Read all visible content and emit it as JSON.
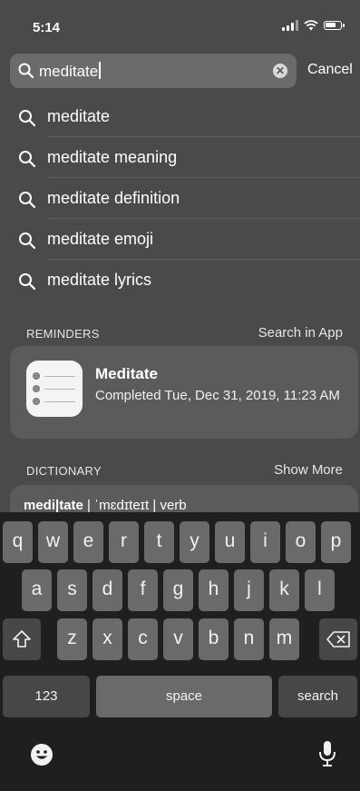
{
  "status_bar": {
    "time": "5:14"
  },
  "search": {
    "query": "meditate",
    "cancel_label": "Cancel"
  },
  "suggestions": [
    "meditate",
    "meditate meaning",
    "meditate definition",
    "meditate emoji",
    "meditate lyrics"
  ],
  "reminders": {
    "header": "REMINDERS",
    "action": "Search in App",
    "result": {
      "title": "Meditate",
      "detail": "Completed Tue, Dec 31, 2019, 11:23 AM",
      "icon": "reminders-app-icon"
    }
  },
  "dictionary": {
    "header": "DICTIONARY",
    "action": "Show More",
    "word": "medi|tate",
    "separator_1": " | ",
    "pronunciation": "ˈmɛdɪteɪt",
    "separator_2": " | ",
    "part_of_speech": "verb"
  },
  "keyboard": {
    "row1": [
      "q",
      "w",
      "e",
      "r",
      "t",
      "y",
      "u",
      "i",
      "o",
      "p"
    ],
    "row2": [
      "a",
      "s",
      "d",
      "f",
      "g",
      "h",
      "j",
      "k",
      "l"
    ],
    "row3": [
      "z",
      "x",
      "c",
      "v",
      "b",
      "n",
      "m"
    ],
    "numbers_label": "123",
    "space_label": "space",
    "search_label": "search",
    "icons": {
      "shift": "shift-icon",
      "delete": "delete-icon",
      "emoji": "emoji-icon",
      "dictation": "microphone-icon"
    }
  }
}
